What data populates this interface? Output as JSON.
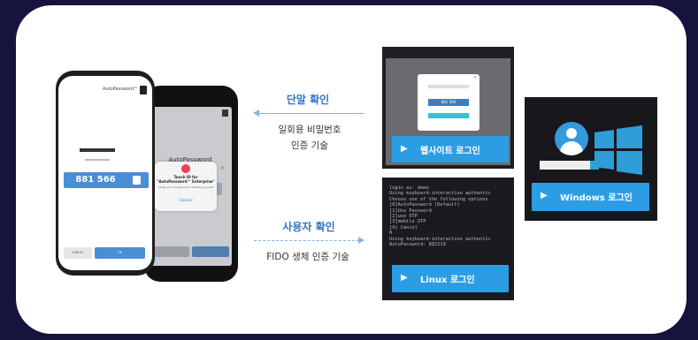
{
  "phone": {
    "back": {
      "app_name": "AutoPassword",
      "dialog_title": "Touch ID for \"AutoPassword™ Enterprise\"",
      "dialog_subtitle": "Verify your fingerprint to identify yourself",
      "dialog_cancel": "Cancel"
    },
    "front": {
      "brand": "AutoPassword™",
      "otp_code": "881 566",
      "cancel_label": "CANCEL",
      "ok_label": "OK"
    }
  },
  "center": {
    "top_heading": "단말 확인",
    "top_line1": "일회용 비밀번호",
    "top_line2": "인증 기술",
    "bottom_heading": "사용자 확인",
    "bottom_line1": "FIDO 생체 인증 기술"
  },
  "website": {
    "modal_otp": "881 566",
    "button_label": "웹사이트 로그인"
  },
  "linux": {
    "terminal_lines": [
      "login as: demo",
      "Using keyboard-interactive authentic",
      "Choose one of the following options",
      "[0]AutoPassword (Default)",
      "[1]Use Password",
      "[2]use OTP",
      "[3]mobile OTP",
      "[4] Cancel",
      "0",
      "Using keyboard-interactive authentic",
      "AutoPassword: 882219"
    ],
    "button_label": "Linux 로그인"
  },
  "windows": {
    "button_label": "Windows 로그인"
  },
  "colors": {
    "background": "#16133f",
    "accent_blue": "#2d9de3",
    "heading_blue": "#2f74c8"
  },
  "icons": {
    "play": "▶",
    "arrow_left": "arrow-left",
    "arrow_right": "arrow-right"
  }
}
